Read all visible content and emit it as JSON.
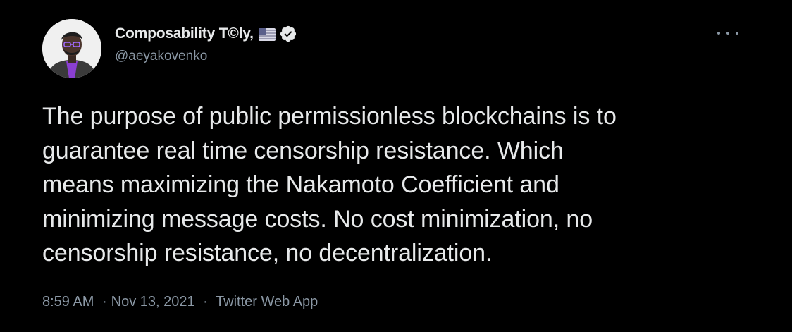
{
  "author": {
    "display_name": "Composability T©ly,",
    "handle": "@aeyakovenko",
    "flag_icon": "us-flag-icon",
    "verified_icon": "verified-badge-icon",
    "avatar_icon": "profile-photo-icon"
  },
  "more_icon": "more-options-icon",
  "tweet": {
    "lines": [
      "The purpose of public permissionless blockchains is to",
      "guarantee real time censorship resistance. Which",
      "means maximizing the Nakamoto Coefficient and",
      "minimizing message costs. No cost minimization, no",
      "censorship resistance, no decentralization."
    ]
  },
  "meta": {
    "time": "8:59 AM",
    "separator": "·",
    "date": "Nov 13, 2021",
    "source": "Twitter Web App"
  },
  "colors": {
    "background": "#000000",
    "text": "#e7e9ea",
    "secondary_text": "#8b98a5",
    "accent": "#9b4dff"
  }
}
